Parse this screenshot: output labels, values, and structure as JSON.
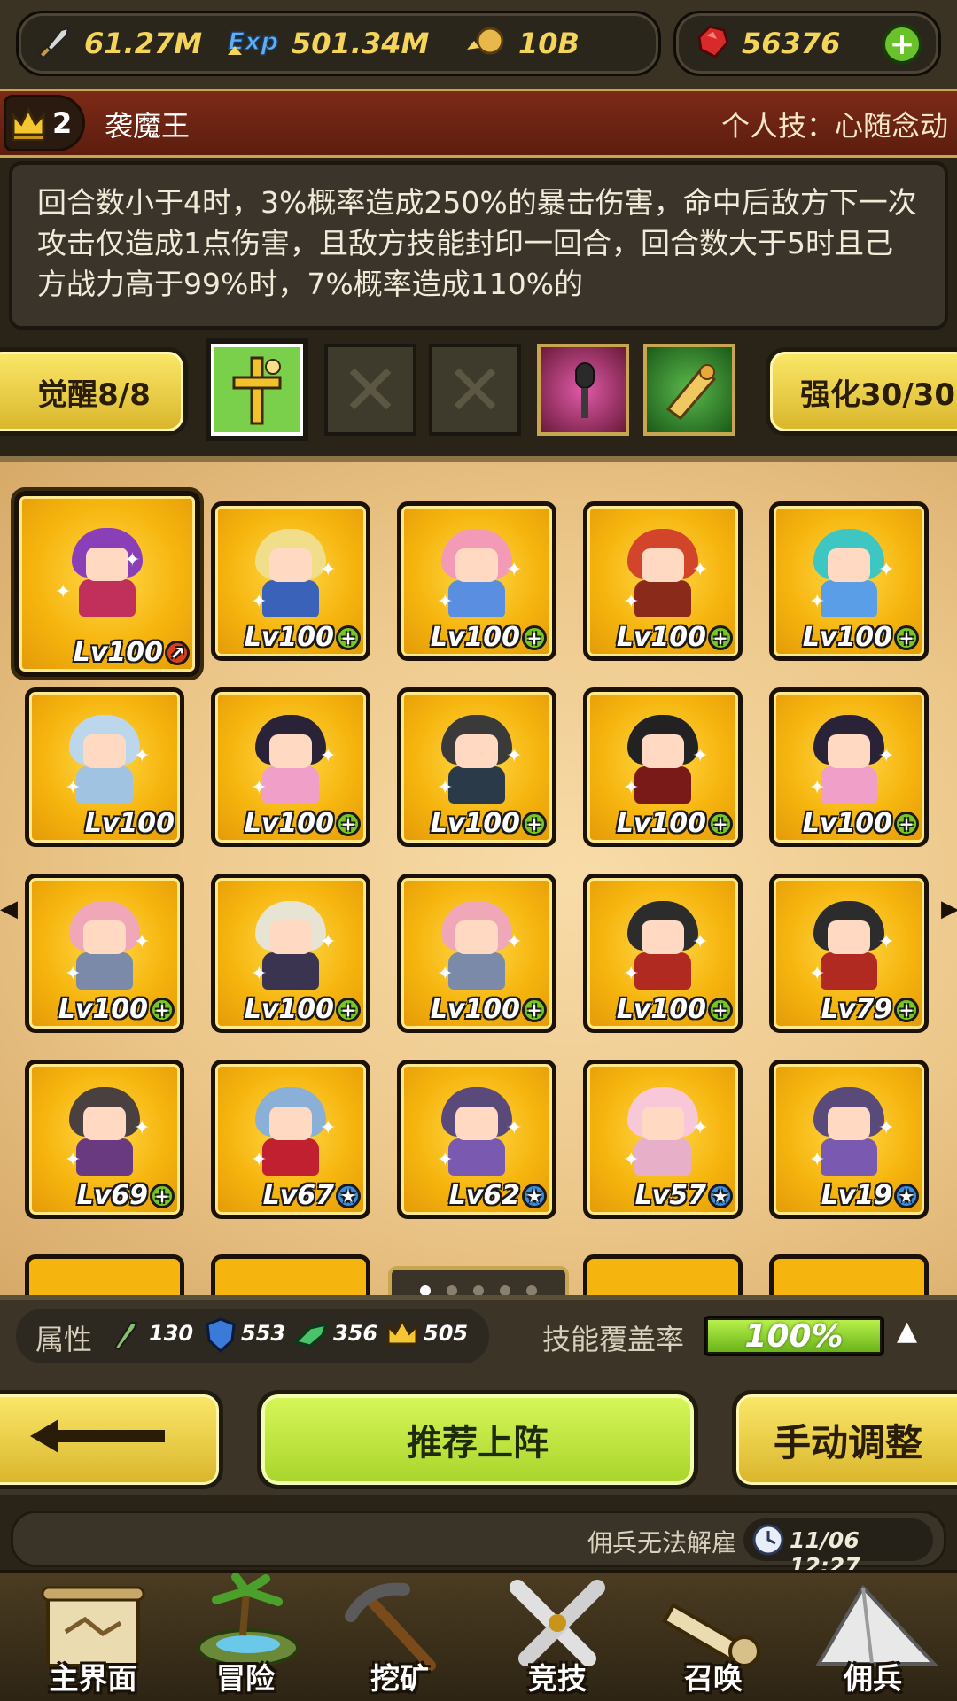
{
  "resources": {
    "attack": {
      "icon": "sword-icon",
      "value": "61.27M"
    },
    "exp": {
      "icon": "exp-icon",
      "value": "501.34M"
    },
    "gold": {
      "icon": "gold-coin-icon",
      "value": "10B"
    },
    "ruby": {
      "icon": "ruby-icon",
      "value": "56376"
    },
    "add_icon": "plus-icon"
  },
  "hero": {
    "rank": "2",
    "name": "袭魔王",
    "personal_skill": "个人技：心随念动"
  },
  "skill_description": "回合数小于4时，3%概率造成250%的暴击伤害，命中后敌方下一次攻击仅造成1点伤害，且敌方技能封印一回合，回合数大于5时且己方战力高于99%时，7%概率造成110%的",
  "awaken_label": "觉醒8/8",
  "enhance_label": "强化30/30",
  "skill_slots": [
    {
      "icon": "golden-cross-icon",
      "state": "selected"
    },
    {
      "icon": "empty-slot-icon",
      "state": "empty"
    },
    {
      "icon": "empty-slot-icon",
      "state": "empty"
    },
    {
      "icon": "microphone-icon",
      "state": "equipped"
    },
    {
      "icon": "scroll-icon",
      "state": "equipped"
    }
  ],
  "mercenaries": [
    {
      "level": "Lv100",
      "badge": "up",
      "selected": true,
      "hair": "#8a3fb8",
      "outfit": "#c0305a"
    },
    {
      "level": "Lv100",
      "badge": "plus",
      "hair": "#f1de8a",
      "outfit": "#3a62b8"
    },
    {
      "level": "Lv100",
      "badge": "plus",
      "hair": "#f29ab6",
      "outfit": "#5a8ee0"
    },
    {
      "level": "Lv100",
      "badge": "plus",
      "hair": "#d2452a",
      "outfit": "#8a2a1a"
    },
    {
      "level": "Lv100",
      "badge": "plus",
      "hair": "#3ec6c2",
      "outfit": "#5a9ee8"
    },
    {
      "level": "Lv100",
      "badge": "none",
      "hair": "#bcd7ec",
      "outfit": "#9fc3e0"
    },
    {
      "level": "Lv100",
      "badge": "plus",
      "hair": "#2a2236",
      "outfit": "#f0a0c8"
    },
    {
      "level": "Lv100",
      "badge": "plus",
      "hair": "#3a3a3a",
      "outfit": "#2a3a48"
    },
    {
      "level": "Lv100",
      "badge": "plus",
      "hair": "#222222",
      "outfit": "#7a1a18"
    },
    {
      "level": "Lv100",
      "badge": "plus",
      "hair": "#2a2236",
      "outfit": "#f0a0c8"
    },
    {
      "level": "Lv100",
      "badge": "plus",
      "hair": "#f0a8b8",
      "outfit": "#7a8aa8"
    },
    {
      "level": "Lv100",
      "badge": "plus",
      "hair": "#e8e4d4",
      "outfit": "#3a3450"
    },
    {
      "level": "Lv100",
      "badge": "plus",
      "hair": "#f0a8b8",
      "outfit": "#7a8aa8"
    },
    {
      "level": "Lv100",
      "badge": "plus",
      "hair": "#2c2c2c",
      "outfit": "#b02a22"
    },
    {
      "level": "Lv79",
      "badge": "plus",
      "hair": "#2c2c2c",
      "outfit": "#b02a22"
    },
    {
      "level": "Lv69",
      "badge": "plus",
      "hair": "#4a4040",
      "outfit": "#6a3a80"
    },
    {
      "level": "Lv67",
      "badge": "star",
      "hair": "#8ab0d8",
      "outfit": "#c02030"
    },
    {
      "level": "Lv62",
      "badge": "star",
      "hair": "#5a4a7a",
      "outfit": "#7a5ab0"
    },
    {
      "level": "Lv57",
      "badge": "star",
      "hair": "#f8c8d8",
      "outfit": "#e8b0c8"
    },
    {
      "level": "Lv19",
      "badge": "star",
      "hair": "#5a4a7a",
      "outfit": "#7a5ab0"
    }
  ],
  "stats": {
    "label": "属性",
    "items": [
      {
        "icon": "sword-icon",
        "value": "130"
      },
      {
        "icon": "shield-icon",
        "value": "553"
      },
      {
        "icon": "boot-icon",
        "value": "356"
      },
      {
        "icon": "crown-icon",
        "value": "505"
      }
    ],
    "coverage_label": "技能覆盖率",
    "coverage_value": "100%",
    "coverage_fraction": 1.0
  },
  "buttons": {
    "back_icon": "back-arrow-icon",
    "recommend": "推荐上阵",
    "manual": "手动调整"
  },
  "notice": {
    "text": "佣兵无法解雇",
    "time": "11/06 12:27"
  },
  "nav": [
    {
      "label": "主界面",
      "icon": "map-icon"
    },
    {
      "label": "冒险",
      "icon": "island-icon"
    },
    {
      "label": "挖矿",
      "icon": "pickaxe-icon"
    },
    {
      "label": "竞技",
      "icon": "crossed-swords-icon"
    },
    {
      "label": "召唤",
      "icon": "summon-scroll-icon"
    },
    {
      "label": "佣兵",
      "icon": "tent-icon"
    }
  ],
  "colors": {
    "accent_yellow": "#f4d55a",
    "green_button": "#c8ee3e",
    "coverage_green": "#8fd62a",
    "hero_bar_red": "#7d2a17"
  }
}
